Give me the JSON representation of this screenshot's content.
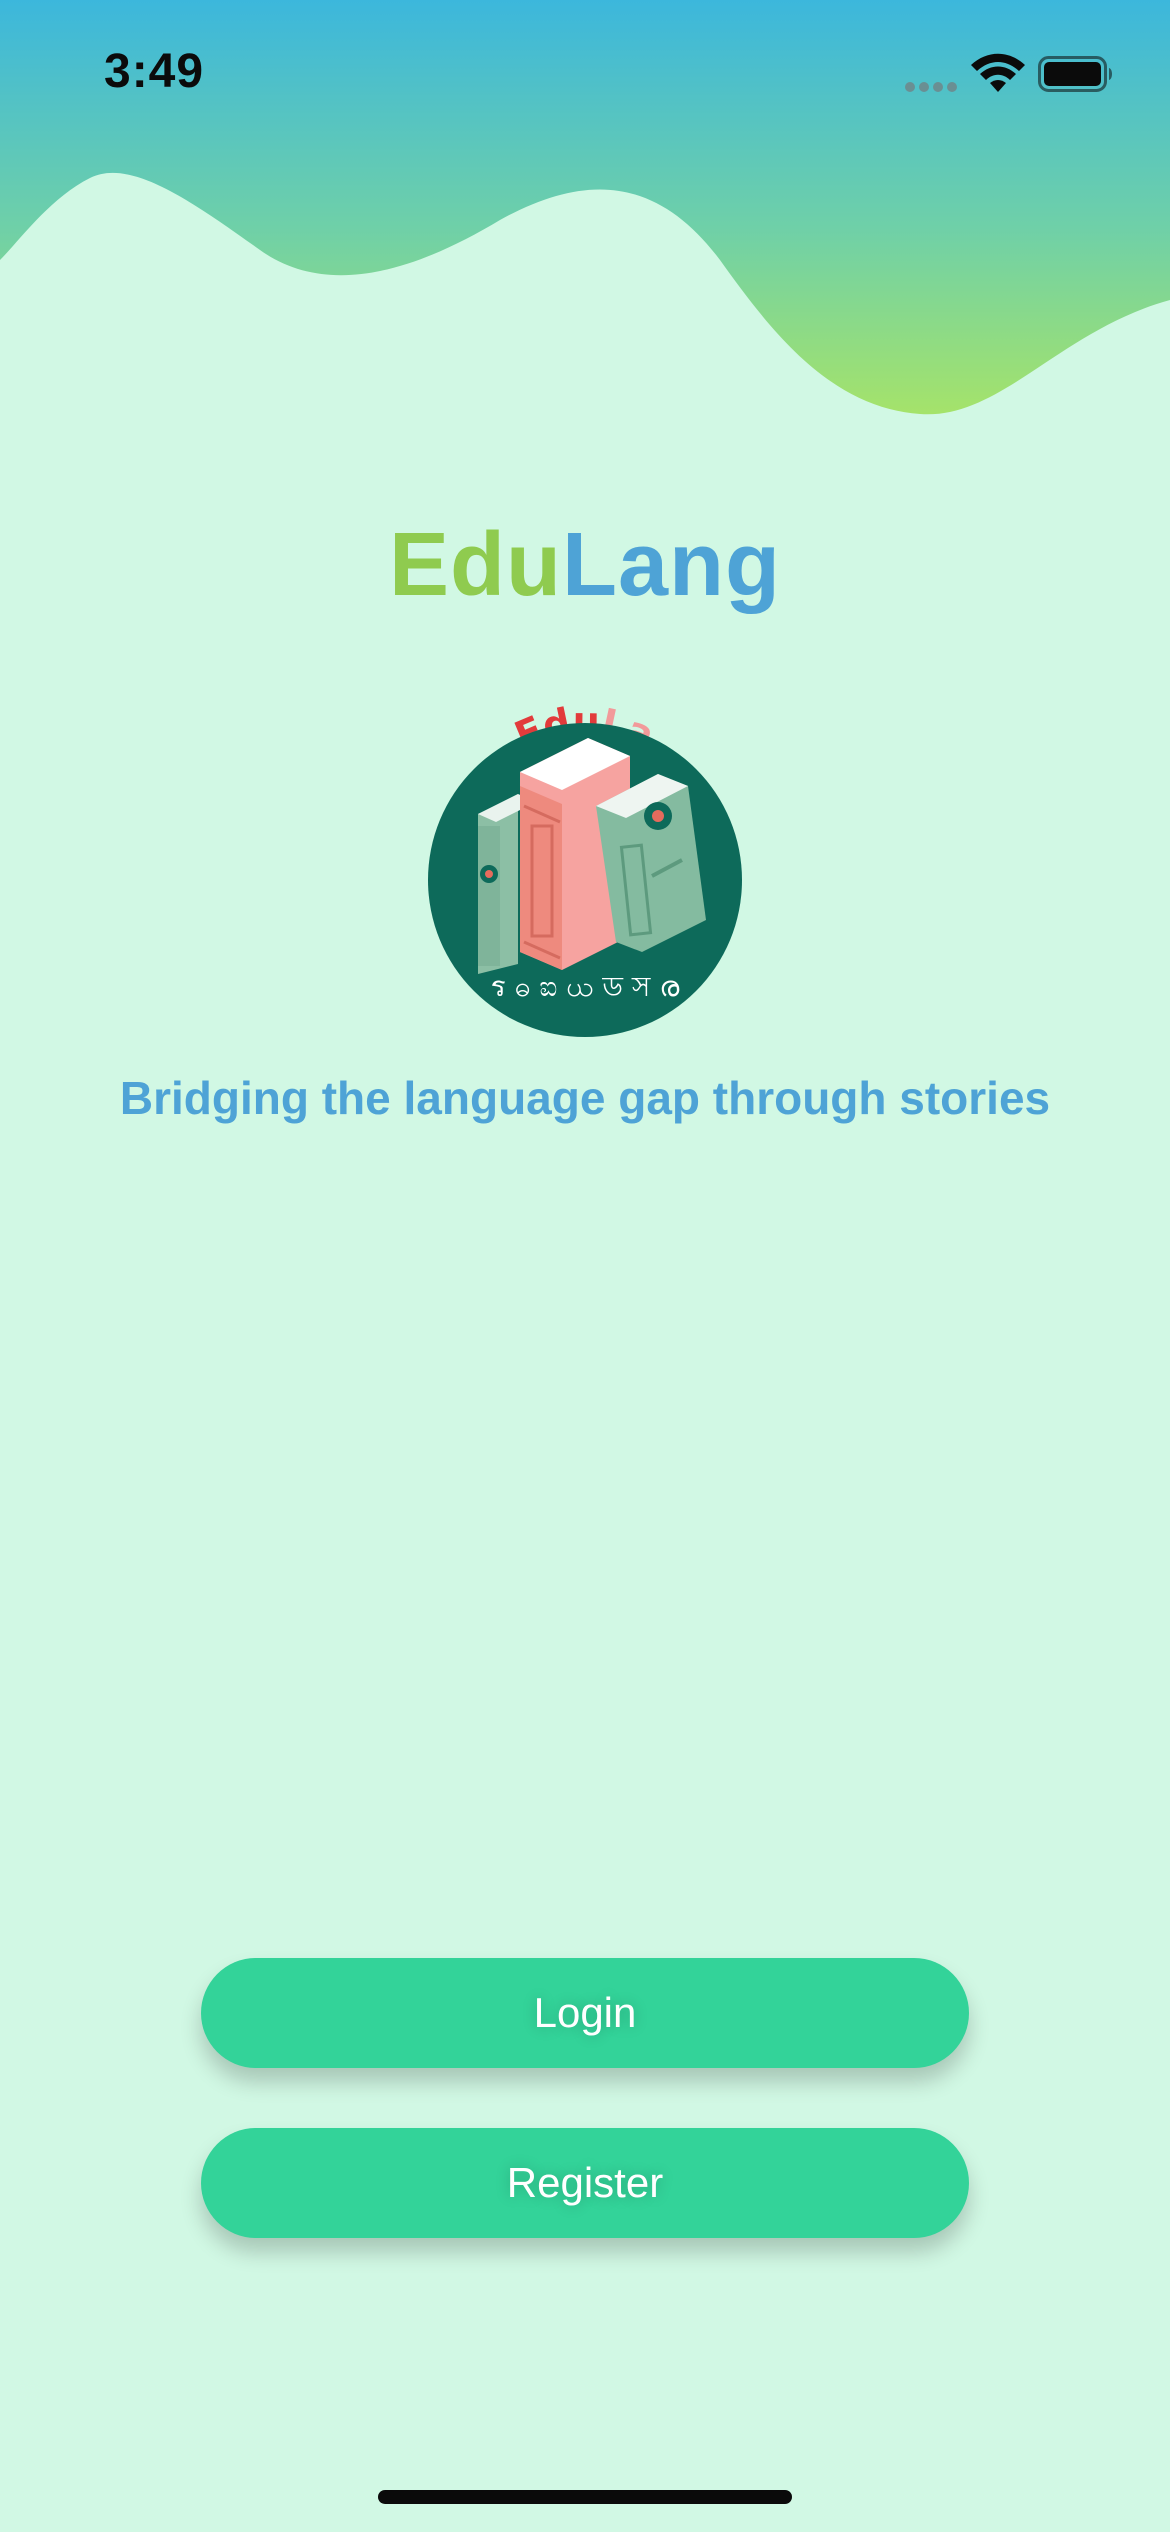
{
  "status_bar": {
    "time": "3:49",
    "icons": [
      "cellular-signal-icon",
      "wifi-icon",
      "battery-icon"
    ]
  },
  "app": {
    "title_part_1": "Edu",
    "title_part_2": "Lang",
    "tagline": "Bridging the language gap through stories"
  },
  "logo": {
    "wordmark_part_1": "Edu",
    "wordmark_part_2": "Lang",
    "script_characters": "ร ဓ ಐ ယ ড স ര"
  },
  "actions": {
    "login_label": "Login",
    "register_label": "Register"
  },
  "colors": {
    "background": "#d1f8e4",
    "header_gradient_top": "#3cb7dc",
    "header_gradient_bottom": "#a5e36a",
    "title_part_1": "#8fcb4f",
    "title_part_2": "#4ea3d6",
    "tagline": "#4ea3d6",
    "button": "#33d399",
    "button_text": "#ffffff",
    "logo_circle": "#0d6a5a"
  }
}
